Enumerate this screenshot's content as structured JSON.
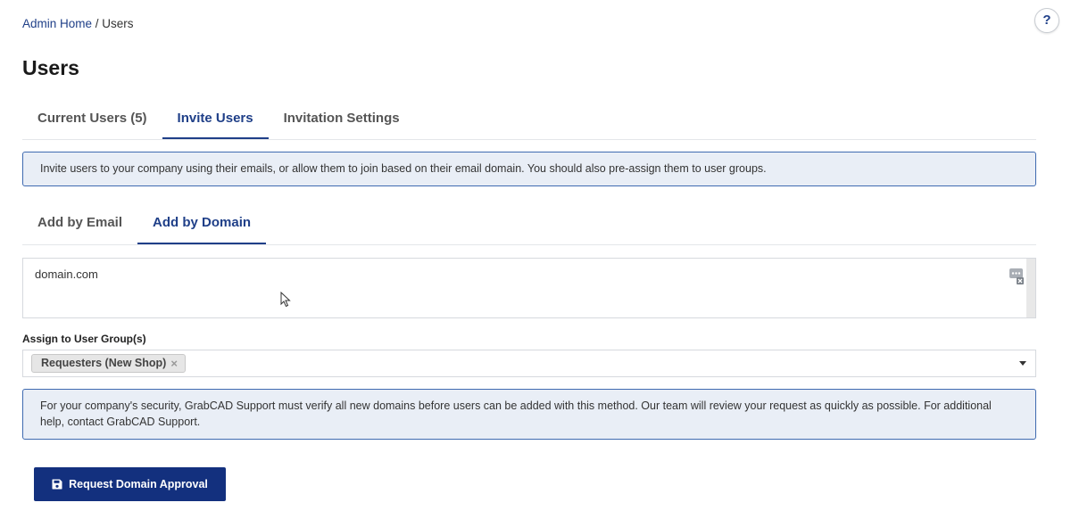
{
  "breadcrumb": {
    "home": "Admin Home",
    "separator": " / ",
    "current": "Users"
  },
  "help": {
    "label": "?"
  },
  "page_title": "Users",
  "main_tabs": [
    {
      "label": "Current Users (5)",
      "active": false
    },
    {
      "label": "Invite Users",
      "active": true
    },
    {
      "label": "Invitation Settings",
      "active": false
    }
  ],
  "invite_info": "Invite users to your company using their emails, or allow them to join based on their email domain. You should also pre-assign them to user groups.",
  "sub_tabs": [
    {
      "label": "Add by Email",
      "active": false
    },
    {
      "label": "Add by Domain",
      "active": true
    }
  ],
  "domain_field": {
    "value": "domain.com"
  },
  "user_group": {
    "label": "Assign to User Group(s)",
    "tags": [
      {
        "label": "Requesters (New Shop)",
        "remove": "×"
      }
    ]
  },
  "security_notice": "For your company's security, GrabCAD Support must verify all new domains before users can be added with this method. Our team will review your request as quickly as possible. For additional help, contact GrabCAD Support.",
  "request_button": {
    "label": "Request Domain Approval"
  },
  "colors": {
    "accent": "#1f3f88",
    "button": "#13307e",
    "info_bg": "#e9eef6",
    "info_border": "#3f6ab0"
  }
}
